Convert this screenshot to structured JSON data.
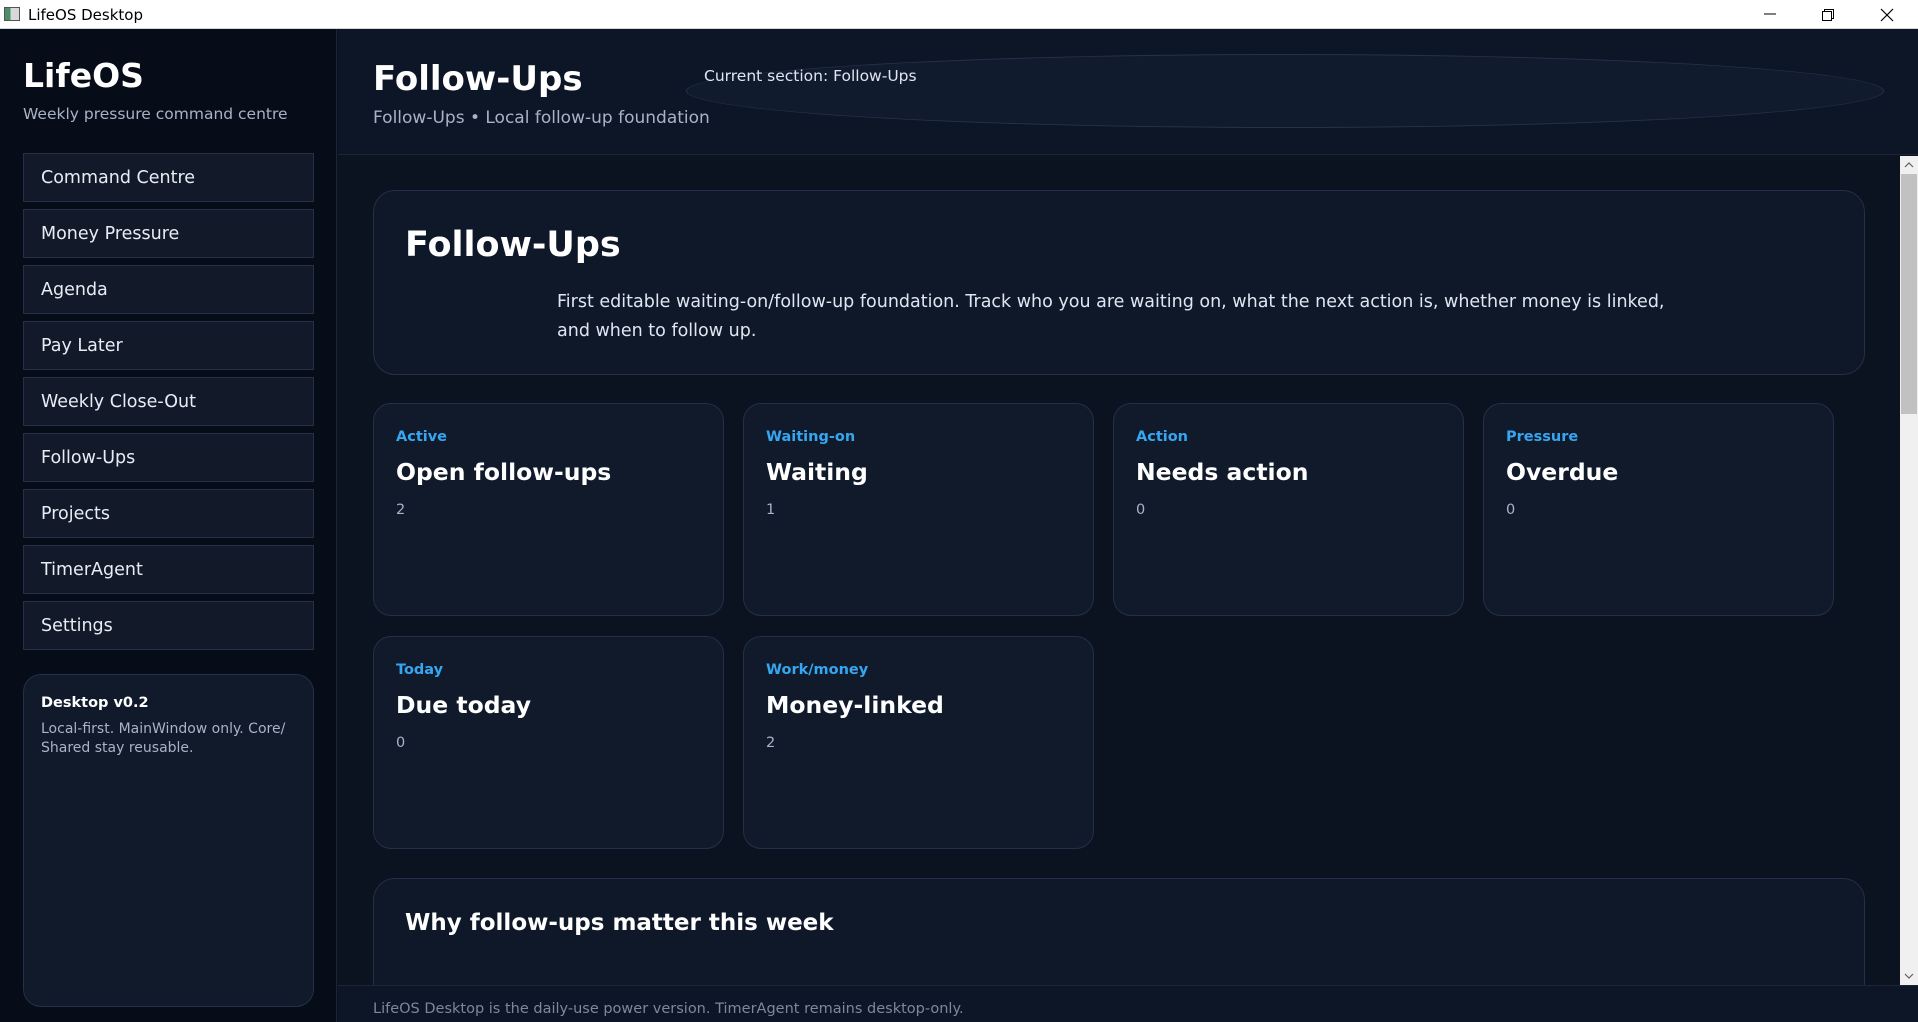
{
  "window": {
    "title": "LifeOS Desktop"
  },
  "sidebar": {
    "brand": "LifeOS",
    "tagline": "Weekly pressure command centre",
    "items": [
      {
        "label": "Command Centre"
      },
      {
        "label": "Money Pressure"
      },
      {
        "label": "Agenda"
      },
      {
        "label": "Pay Later"
      },
      {
        "label": "Weekly Close-Out"
      },
      {
        "label": "Follow-Ups"
      },
      {
        "label": "Projects"
      },
      {
        "label": "TimerAgent"
      },
      {
        "label": "Settings"
      }
    ],
    "version": {
      "title": "Desktop v0.2",
      "text": "Local-first. MainWindow only. Core/ Shared stay reusable."
    }
  },
  "header": {
    "title": "Follow-Ups",
    "subtitle": "Follow-Ups • Local follow-up foundation",
    "current_section": "Current section: Follow-Ups"
  },
  "intro": {
    "title": "Follow-Ups",
    "text": "First editable waiting-on/follow-up foundation. Track who you are waiting on, what the next action is, whether money is linked, and when to follow up."
  },
  "stats": [
    {
      "kicker": "Active",
      "title": "Open follow-ups",
      "value": "2"
    },
    {
      "kicker": "Waiting-on",
      "title": "Waiting",
      "value": "1"
    },
    {
      "kicker": "Action",
      "title": "Needs action",
      "value": "0"
    },
    {
      "kicker": "Pressure",
      "title": "Overdue",
      "value": "0"
    },
    {
      "kicker": "Today",
      "title": "Due today",
      "value": "0"
    },
    {
      "kicker": "Work/money",
      "title": "Money-linked",
      "value": "2"
    }
  ],
  "why": {
    "title": "Why follow-ups matter this week"
  },
  "footer": {
    "text": "LifeOS Desktop is the daily-use power version. TimerAgent remains desktop-only."
  },
  "colors": {
    "accent": "#37a6f0",
    "background": "#0b1220",
    "card": "#101a2b"
  }
}
